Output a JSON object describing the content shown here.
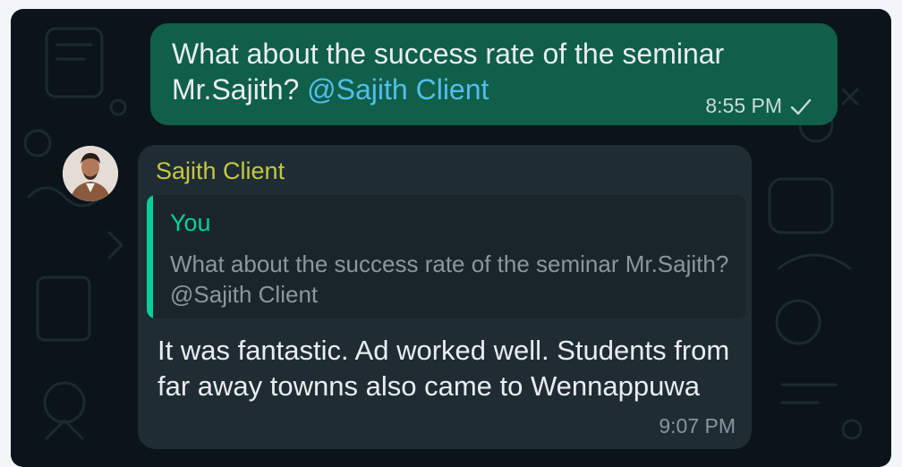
{
  "outgoing": {
    "text": "What about the success rate of the seminar Mr.Sajith?",
    "mention": "@Sajith Client",
    "time": "8:55 PM",
    "status_icon": "single-check-icon"
  },
  "incoming": {
    "sender": "Sajith Client",
    "quote": {
      "author": "You",
      "text": "What about the success rate of the seminar Mr.Sajith? @Sajith Client"
    },
    "text": "It was fantastic. Ad worked well. Students from far away townns also came to Wennappuwa",
    "time": "9:07 PM"
  },
  "colors": {
    "chat_background": "#0b141a",
    "outgoing_bubble": "#0f5f49",
    "incoming_bubble": "#1f2c33",
    "sender_name": "#c3c842",
    "quote_accent": "#06cf9c",
    "mention": "#53bdeb"
  }
}
